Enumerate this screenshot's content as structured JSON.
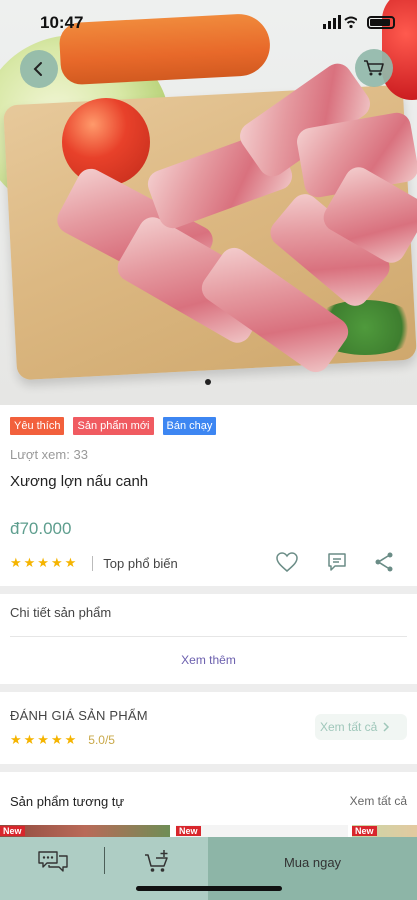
{
  "status_bar": {
    "time": "10:47"
  },
  "colors": {
    "accent": "#8db5a7",
    "price": "#5e9e8e",
    "badge_favorite": "#f2603c",
    "badge_new": "#f05b61",
    "badge_bestseller": "#3d86f2",
    "star": "#f5b400"
  },
  "header": {
    "back_icon": "chevron-left-icon",
    "cart_icon": "cart-icon"
  },
  "product": {
    "badges": [
      {
        "label": "Yêu thích",
        "color": "#f2603c"
      },
      {
        "label": "Sản phẩm mới",
        "color": "#f05b61"
      },
      {
        "label": "Bán chạy",
        "color": "#3d86f2"
      }
    ],
    "views": "Lượt xem: 33",
    "name": "Xương lợn nấu canh",
    "price": "đ70.000",
    "stars": "★★★★★",
    "rating": 5,
    "popularity": "Top phổ biến"
  },
  "details": {
    "title": "Chi tiết sản phẩm",
    "see_more": "Xem thêm"
  },
  "reviews": {
    "title": "ĐÁNH GIÁ SẢN PHẨM",
    "stars": "★★★★★",
    "score": "5.0/5",
    "see_all": "Xem tất cả"
  },
  "similar": {
    "title": "Sản phẩm tương tự",
    "see_all": "Xem tất cả",
    "new_tag": "New"
  },
  "bottom_bar": {
    "chat_icon": "chat-icon",
    "add_cart_icon": "add-to-cart-icon",
    "buy_now": "Mua ngay"
  }
}
